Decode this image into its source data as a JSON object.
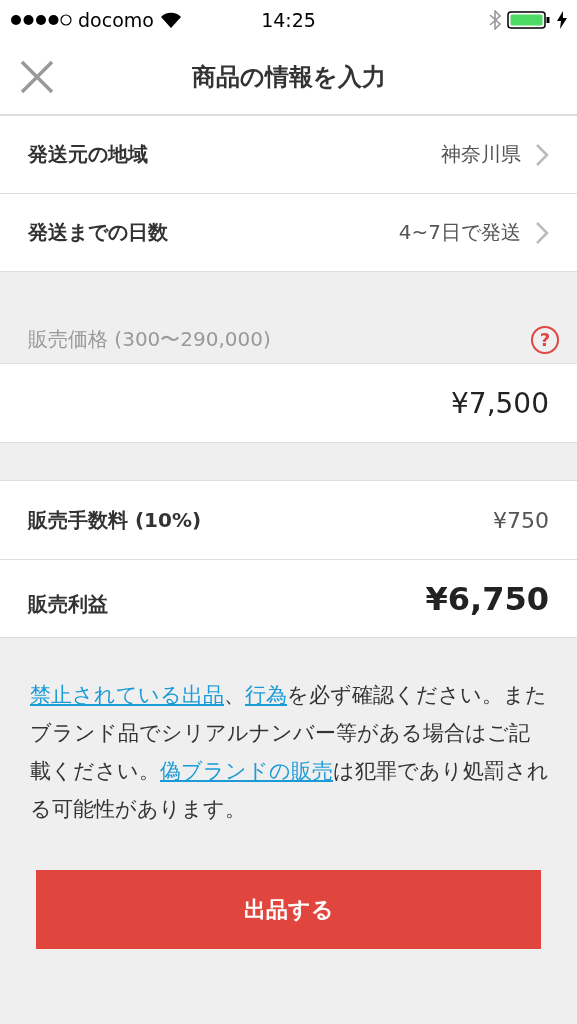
{
  "status_bar": {
    "carrier": "docomo",
    "time": "14:25"
  },
  "header": {
    "title": "商品の情報を入力"
  },
  "shipping_rows": [
    {
      "label": "発送元の地域",
      "value": "神奈川県"
    },
    {
      "label": "発送までの日数",
      "value": "4~7日で発送"
    }
  ],
  "price": {
    "label": "販売価格 (300〜290,000)",
    "help": "?",
    "value": "¥7,500"
  },
  "summary_rows": [
    {
      "kind": "fee",
      "label": "販売手数料 (10%)",
      "value": "¥750"
    },
    {
      "kind": "profit",
      "label": "販売利益",
      "value": "¥6,750"
    }
  ],
  "notice": [
    {
      "kind": "link",
      "text": "禁止されている出品"
    },
    {
      "kind": "text",
      "text": "、"
    },
    {
      "kind": "link",
      "text": "行為"
    },
    {
      "kind": "text",
      "text": "を必ず確認ください。またブランド品でシリアルナンバー等がある場合はご記載ください。"
    },
    {
      "kind": "link",
      "text": "偽ブランドの販売"
    },
    {
      "kind": "text",
      "text": "は犯罪であり処罰される可能性があります。"
    }
  ],
  "submit_button": {
    "label": "出品する"
  }
}
